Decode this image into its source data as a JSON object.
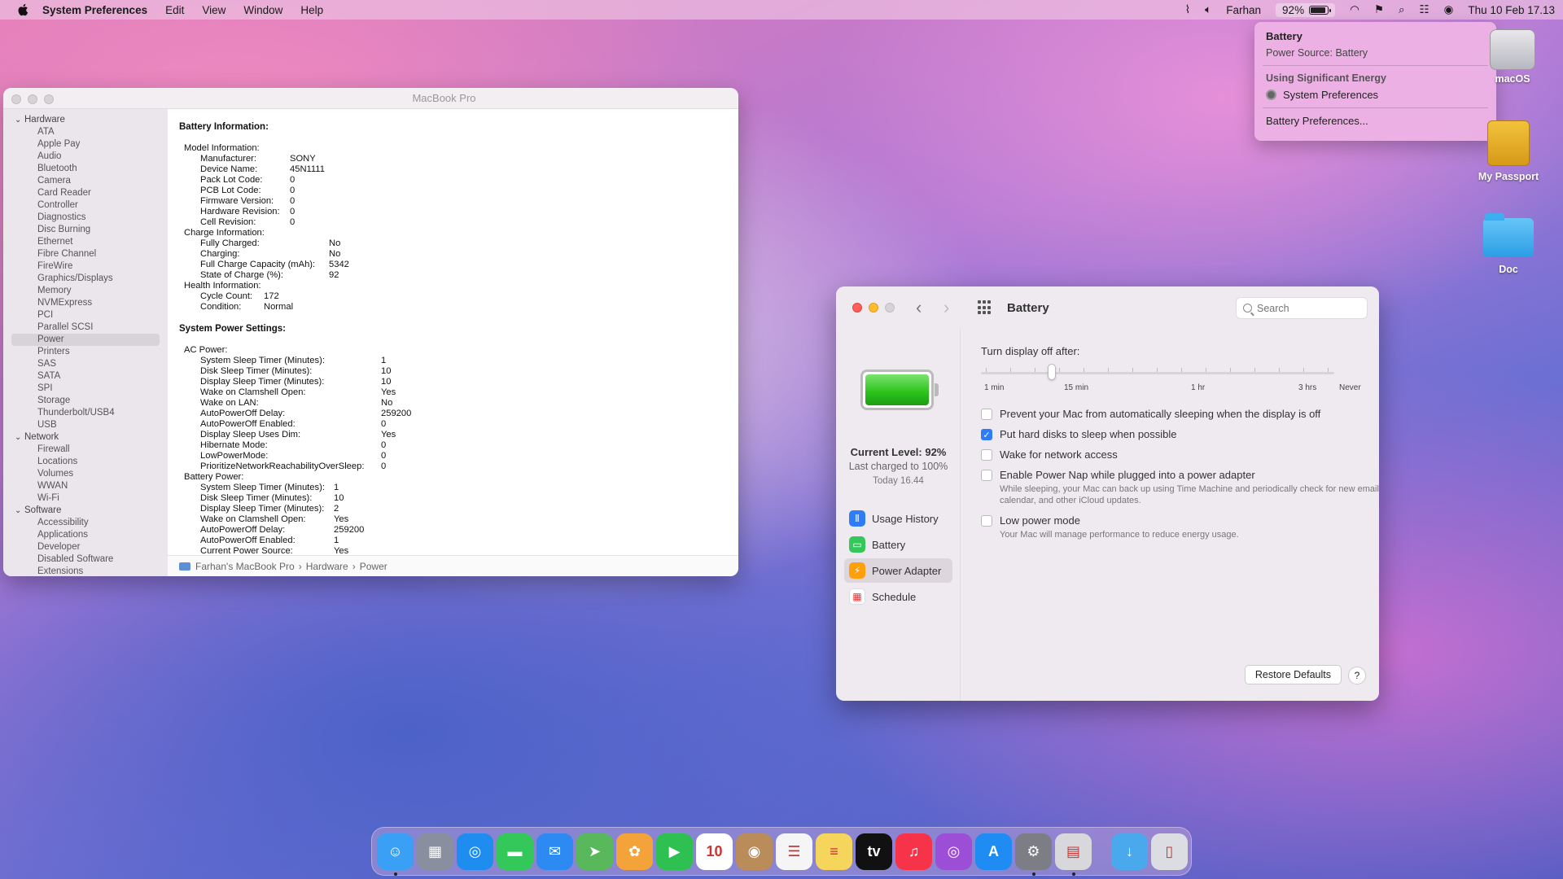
{
  "menubar": {
    "app": "System Preferences",
    "menus": [
      "Edit",
      "View",
      "Window",
      "Help"
    ],
    "user": "Farhan",
    "battery_percent": "92%",
    "datetime": "Thu 10 Feb  17.13"
  },
  "battery_menu": {
    "title": "Battery",
    "source": "Power Source: Battery",
    "energy_heading": "Using Significant Energy",
    "energy_app": "System Preferences",
    "prefs_link": "Battery Preferences..."
  },
  "desktop": {
    "icons": [
      {
        "label": "macOS"
      },
      {
        "label": "My Passport"
      },
      {
        "label": "Doc"
      }
    ]
  },
  "sysinfo": {
    "title": "MacBook Pro",
    "sidebar": [
      {
        "type": "sec",
        "label": "Hardware"
      },
      {
        "type": "it",
        "label": "ATA"
      },
      {
        "type": "it",
        "label": "Apple Pay"
      },
      {
        "type": "it",
        "label": "Audio"
      },
      {
        "type": "it",
        "label": "Bluetooth"
      },
      {
        "type": "it",
        "label": "Camera"
      },
      {
        "type": "it",
        "label": "Card Reader"
      },
      {
        "type": "it",
        "label": "Controller"
      },
      {
        "type": "it",
        "label": "Diagnostics"
      },
      {
        "type": "it",
        "label": "Disc Burning"
      },
      {
        "type": "it",
        "label": "Ethernet"
      },
      {
        "type": "it",
        "label": "Fibre Channel"
      },
      {
        "type": "it",
        "label": "FireWire"
      },
      {
        "type": "it",
        "label": "Graphics/Displays"
      },
      {
        "type": "it",
        "label": "Memory"
      },
      {
        "type": "it",
        "label": "NVMExpress"
      },
      {
        "type": "it",
        "label": "PCI"
      },
      {
        "type": "it",
        "label": "Parallel SCSI"
      },
      {
        "type": "it",
        "label": "Power",
        "selected": true
      },
      {
        "type": "it",
        "label": "Printers"
      },
      {
        "type": "it",
        "label": "SAS"
      },
      {
        "type": "it",
        "label": "SATA"
      },
      {
        "type": "it",
        "label": "SPI"
      },
      {
        "type": "it",
        "label": "Storage"
      },
      {
        "type": "it",
        "label": "Thunderbolt/USB4"
      },
      {
        "type": "it",
        "label": "USB"
      },
      {
        "type": "sec",
        "label": "Network"
      },
      {
        "type": "it",
        "label": "Firewall"
      },
      {
        "type": "it",
        "label": "Locations"
      },
      {
        "type": "it",
        "label": "Volumes"
      },
      {
        "type": "it",
        "label": "WWAN"
      },
      {
        "type": "it",
        "label": "Wi-Fi"
      },
      {
        "type": "sec",
        "label": "Software"
      },
      {
        "type": "it",
        "label": "Accessibility"
      },
      {
        "type": "it",
        "label": "Applications"
      },
      {
        "type": "it",
        "label": "Developer"
      },
      {
        "type": "it",
        "label": "Disabled Software"
      },
      {
        "type": "it",
        "label": "Extensions"
      }
    ],
    "battery_heading": "Battery Information:",
    "battery_groups": [
      {
        "name": "Model Information:",
        "rows": [
          [
            "Manufacturer:",
            "SONY"
          ],
          [
            "Device Name:",
            "45N1111"
          ],
          [
            "Pack Lot Code:",
            "0"
          ],
          [
            "PCB Lot Code:",
            "0"
          ],
          [
            "Firmware Version:",
            "0"
          ],
          [
            "Hardware Revision:",
            "0"
          ],
          [
            "Cell Revision:",
            "0"
          ]
        ]
      },
      {
        "name": "Charge Information:",
        "rows": [
          [
            "Fully Charged:",
            "No"
          ],
          [
            "Charging:",
            "No"
          ],
          [
            "Full Charge Capacity (mAh):",
            "5342"
          ],
          [
            "State of Charge (%):",
            "92"
          ]
        ]
      },
      {
        "name": "Health Information:",
        "rows": [
          [
            "Cycle Count:",
            "172"
          ],
          [
            "Condition:",
            "Normal"
          ]
        ]
      }
    ],
    "power_heading": "System Power Settings:",
    "power_groups": [
      {
        "name": "AC Power:",
        "rows": [
          [
            "System Sleep Timer (Minutes):",
            "1"
          ],
          [
            "Disk Sleep Timer (Minutes):",
            "10"
          ],
          [
            "Display Sleep Timer (Minutes):",
            "10"
          ],
          [
            "Wake on Clamshell Open:",
            "Yes"
          ],
          [
            "Wake on LAN:",
            "No"
          ],
          [
            "AutoPowerOff Delay:",
            "259200"
          ],
          [
            "AutoPowerOff Enabled:",
            "0"
          ],
          [
            "Display Sleep Uses Dim:",
            "Yes"
          ],
          [
            "Hibernate Mode:",
            "0"
          ],
          [
            "LowPowerMode:",
            "0"
          ],
          [
            "PrioritizeNetworkReachabilityOverSleep:",
            "0"
          ]
        ]
      },
      {
        "name": "Battery Power:",
        "rows": [
          [
            "System Sleep Timer (Minutes):",
            "1"
          ],
          [
            "Disk Sleep Timer (Minutes):",
            "10"
          ],
          [
            "Display Sleep Timer (Minutes):",
            "2"
          ],
          [
            "Wake on Clamshell Open:",
            "Yes"
          ],
          [
            "AutoPowerOff Delay:",
            "259200"
          ],
          [
            "AutoPowerOff Enabled:",
            "1"
          ],
          [
            "Current Power Source:",
            "Yes"
          ]
        ]
      }
    ],
    "breadcrumb": [
      "Farhan's MacBook Pro",
      "Hardware",
      "Power"
    ]
  },
  "prefs": {
    "title": "Battery",
    "search_placeholder": "Search",
    "current_level": "Current Level: 92%",
    "last_charged": "Last charged to 100%",
    "charged_time": "Today 16.44",
    "nav": [
      {
        "label": "Usage History",
        "color": "#2f7cf6",
        "glyph": "Ⅱ"
      },
      {
        "label": "Battery",
        "color": "#34c759",
        "glyph": "▭"
      },
      {
        "label": "Power Adapter",
        "color": "#ff9f0a",
        "glyph": "⚡",
        "selected": true
      },
      {
        "label": "Schedule",
        "color": "#ffffff",
        "glyph": "▦"
      }
    ],
    "display_off_label": "Turn display off after:",
    "slider_value": "15 min",
    "slider_labels": [
      "1 min",
      "15 min",
      "1 hr",
      "3 hrs",
      "Never"
    ],
    "options": [
      {
        "label": "Prevent your Mac from automatically sleeping when the display is off",
        "checked": false,
        "sub": ""
      },
      {
        "label": "Put hard disks to sleep when possible",
        "checked": true,
        "sub": ""
      },
      {
        "label": "Wake for network access",
        "checked": false,
        "sub": ""
      },
      {
        "label": "Enable Power Nap while plugged into a power adapter",
        "checked": false,
        "sub": "While sleeping, your Mac can back up using Time Machine and periodically check for new email, calendar, and other iCloud updates."
      },
      {
        "label": "Low power mode",
        "checked": false,
        "sub": "Your Mac will manage performance to reduce energy usage."
      }
    ],
    "restore_label": "Restore Defaults",
    "help_label": "?"
  },
  "dock": {
    "apps": [
      {
        "name": "finder",
        "color": "#3aa0f5",
        "glyph": "☺",
        "running": true
      },
      {
        "name": "launchpad",
        "color": "#8a8fa0",
        "glyph": "▦"
      },
      {
        "name": "safari",
        "color": "#1f8cf0",
        "glyph": "◎"
      },
      {
        "name": "messages",
        "color": "#34c759",
        "glyph": "▬"
      },
      {
        "name": "mail",
        "color": "#2c8af2",
        "glyph": "✉"
      },
      {
        "name": "maps",
        "color": "#5ab85c",
        "glyph": "➤"
      },
      {
        "name": "photos",
        "color": "#f3a33a",
        "glyph": "✿"
      },
      {
        "name": "facetime",
        "color": "#2ec050",
        "glyph": "▶"
      },
      {
        "name": "calendar",
        "color": "#ffffff",
        "glyph": "10"
      },
      {
        "name": "contacts",
        "color": "#b98c5a",
        "glyph": "◉"
      },
      {
        "name": "reminders",
        "color": "#f5f5f5",
        "glyph": "☰"
      },
      {
        "name": "notes",
        "color": "#f6d55c",
        "glyph": "≡"
      },
      {
        "name": "apple-tv",
        "color": "#111111",
        "glyph": "tv"
      },
      {
        "name": "music",
        "color": "#f7334a",
        "glyph": "♫"
      },
      {
        "name": "podcasts",
        "color": "#9c4fd6",
        "glyph": "◎"
      },
      {
        "name": "app-store",
        "color": "#1e8cf2",
        "glyph": "A"
      },
      {
        "name": "system-preferences",
        "color": "#7d7d85",
        "glyph": "⚙",
        "running": true
      },
      {
        "name": "system-information",
        "color": "#d8d8dc",
        "glyph": "▤",
        "running": true
      }
    ],
    "others": [
      {
        "name": "downloads",
        "color": "#4aa9ec",
        "glyph": "↓"
      },
      {
        "name": "trash",
        "color": "#dcdde2",
        "glyph": "▯"
      }
    ]
  }
}
